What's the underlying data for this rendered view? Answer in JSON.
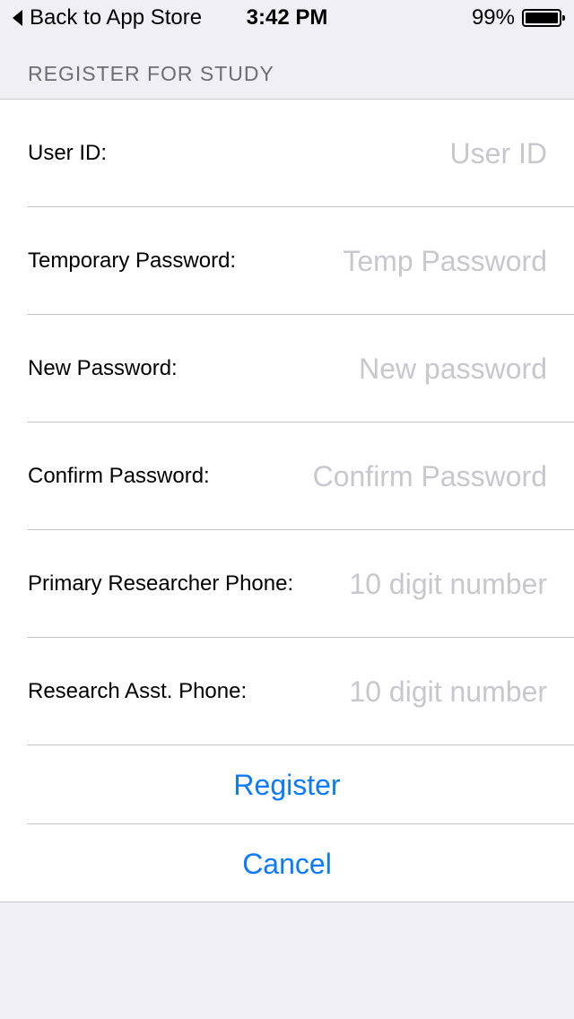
{
  "status_bar": {
    "back_label": "Back to App Store",
    "time": "3:42 PM",
    "battery_text": "99%",
    "battery_level": 0.99
  },
  "section": {
    "title": "REGISTER FOR STUDY"
  },
  "form": {
    "fields": [
      {
        "label": "User ID:",
        "placeholder": "User ID"
      },
      {
        "label": "Temporary Password:",
        "placeholder": "Temp Password"
      },
      {
        "label": "New Password:",
        "placeholder": "New password"
      },
      {
        "label": "Confirm Password:",
        "placeholder": "Confirm Password"
      },
      {
        "label": "Primary Researcher Phone:",
        "placeholder": "10 digit number"
      },
      {
        "label": "Research Asst. Phone:",
        "placeholder": "10 digit number"
      }
    ]
  },
  "actions": {
    "register_label": "Register",
    "cancel_label": "Cancel"
  },
  "colors": {
    "background": "#efeff4",
    "accent": "#0a7aff",
    "placeholder": "#c7c7cd",
    "separator": "#c8c7cc",
    "header_text": "#6d6d72"
  }
}
